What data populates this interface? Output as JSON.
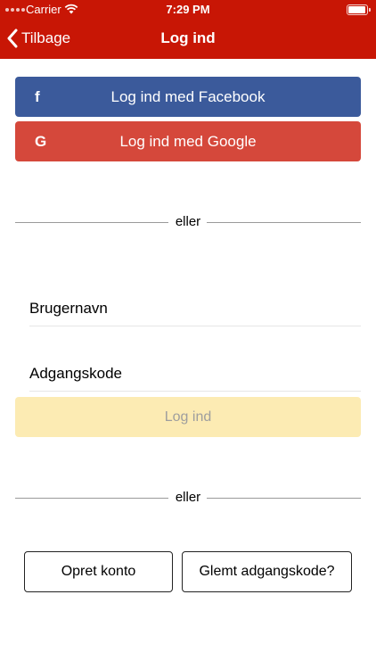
{
  "status_bar": {
    "carrier": "Carrier",
    "time": "7:29 PM"
  },
  "nav": {
    "back_label": "Tilbage",
    "title": "Log ind"
  },
  "social": {
    "facebook_label": "Log ind med Facebook",
    "facebook_icon_glyph": "f",
    "google_label": "Log ind med Google",
    "google_icon_glyph": "G"
  },
  "dividers": {
    "top": "eller",
    "bottom": "eller"
  },
  "form": {
    "username_placeholder": "Brugernavn",
    "username_value": "",
    "password_placeholder": "Adgangskode",
    "password_value": "",
    "login_label": "Log ind"
  },
  "footer": {
    "create_account_label": "Opret konto",
    "forgot_password_label": "Glemt adgangskode?"
  },
  "colors": {
    "header": "#c81605",
    "facebook": "#3b5a9b",
    "google": "#d5483b",
    "login_button": "#fcebb3",
    "login_button_text": "#9e9e9e"
  },
  "icons": [
    "signal-icon",
    "wifi-icon",
    "battery-icon",
    "chevron-left-icon",
    "facebook-icon",
    "google-icon"
  ]
}
